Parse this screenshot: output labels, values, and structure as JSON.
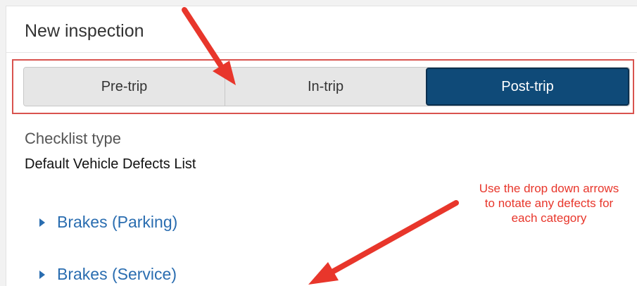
{
  "page": {
    "title": "New inspection"
  },
  "trip_tabs": [
    {
      "label": "Pre-trip",
      "selected": false
    },
    {
      "label": "In-trip",
      "selected": false
    },
    {
      "label": "Post-trip",
      "selected": true
    }
  ],
  "checklist": {
    "label": "Checklist type",
    "value": "Default Vehicle Defects List"
  },
  "categories": [
    {
      "label": "Brakes (Parking)",
      "icon": "caret-right-icon"
    },
    {
      "label": "Brakes (Service)",
      "icon": "caret-right-icon"
    }
  ],
  "annotation": {
    "note": "Use the drop down arrows to notate any defects for each category",
    "color": "#e8362b"
  },
  "colors": {
    "selected_tab": "#0f4a78",
    "link": "#2a6db0",
    "highlight_border": "#d9534f"
  }
}
